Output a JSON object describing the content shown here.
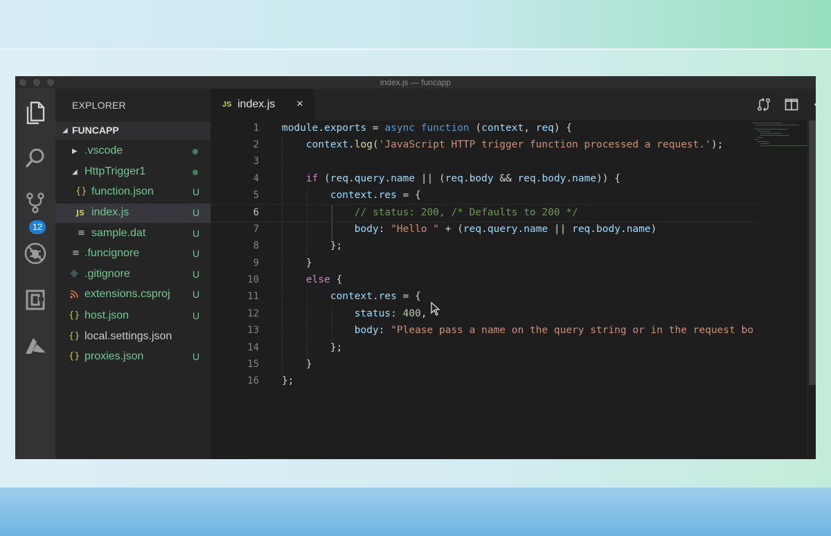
{
  "window": {
    "title": "index.js — funcapp"
  },
  "activity_bar": {
    "icons": [
      "files-icon",
      "search-icon",
      "source-control-icon",
      "debug-icon",
      "extensions-icon",
      "azure-icon"
    ],
    "source_control_badge": "12"
  },
  "sidebar": {
    "title": "EXPLORER",
    "folder": "FUNCAPP",
    "items": [
      {
        "label": ".vscode",
        "status": ""
      },
      {
        "label": "HttpTrigger1",
        "status": ""
      },
      {
        "label": "function.json",
        "status": "U"
      },
      {
        "label": "index.js",
        "status": "U"
      },
      {
        "label": "sample.dat",
        "status": "U"
      },
      {
        "label": ".funcignore",
        "status": "U"
      },
      {
        "label": ".gitignore",
        "status": "U"
      },
      {
        "label": "extensions.csproj",
        "status": "U"
      },
      {
        "label": "host.json",
        "status": "U"
      },
      {
        "label": "local.settings.json",
        "status": ""
      },
      {
        "label": "proxies.json",
        "status": "U"
      }
    ],
    "file_icons": {
      "json": "{}",
      "js": "JS",
      "dat": "≡",
      "csproj": "rss-icon",
      "git": "git-icon"
    }
  },
  "editor": {
    "tab": {
      "label": "index.js",
      "icon": "JS",
      "close": "×"
    },
    "active_line": 6,
    "line_numbers": [
      "1",
      "2",
      "3",
      "4",
      "5",
      "6",
      "7",
      "8",
      "9",
      "10",
      "11",
      "12",
      "13",
      "14",
      "15",
      "16"
    ],
    "lines": [
      "module.exports = async function (context, req) {",
      "    context.log('JavaScript HTTP trigger function processed a request.');",
      "",
      "    if (req.query.name || (req.body && req.body.name)) {",
      "        context.res = {",
      "            // status: 200, /* Defaults to 200 */",
      "            body: \"Hello \" + (req.query.name || req.body.name)",
      "        };",
      "    }",
      "    else {",
      "        context.res = {",
      "            status: 400,",
      "            body: \"Please pass a name on the query string or in the request boo",
      "        };",
      "    }",
      "};"
    ]
  },
  "colors": {
    "keyword": "#569cd6",
    "control": "#c586c0",
    "string": "#ce9178",
    "comment": "#6a9955",
    "number": "#b5cea8",
    "untracked": "#73c991"
  }
}
